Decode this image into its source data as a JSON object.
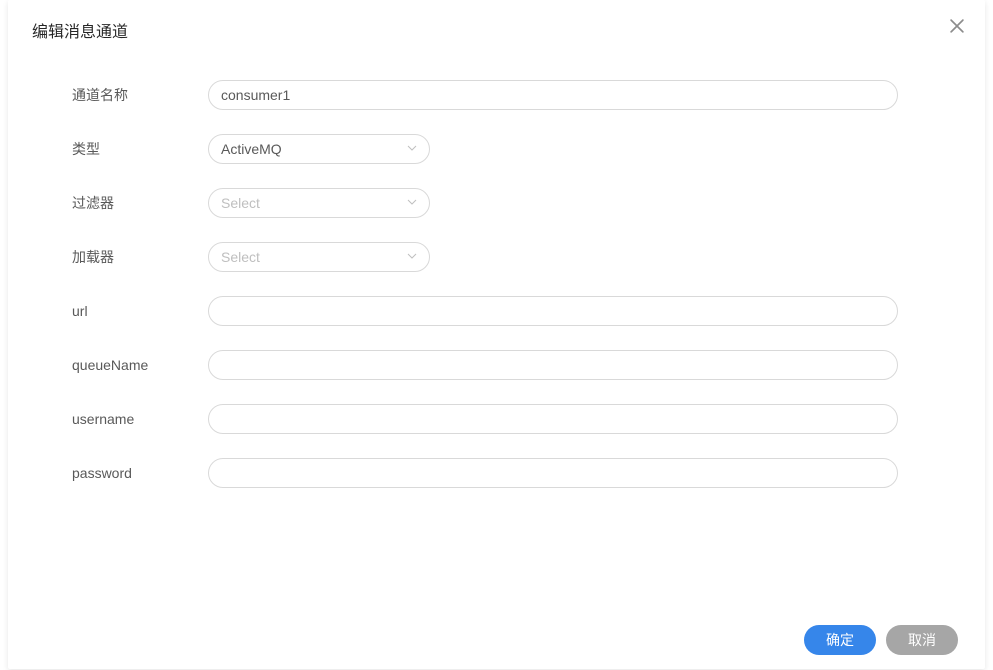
{
  "modal": {
    "title": "编辑消息通道"
  },
  "form": {
    "channelName": {
      "label": "通道名称",
      "value": "consumer1"
    },
    "type": {
      "label": "类型",
      "value": "ActiveMQ"
    },
    "filter": {
      "label": "过滤器",
      "placeholder": "Select",
      "value": ""
    },
    "loader": {
      "label": "加载器",
      "placeholder": "Select",
      "value": ""
    },
    "url": {
      "label": "url",
      "value": ""
    },
    "queueName": {
      "label": "queueName",
      "value": ""
    },
    "username": {
      "label": "username",
      "value": ""
    },
    "password": {
      "label": "password",
      "value": ""
    }
  },
  "footer": {
    "confirm": "确定",
    "cancel": "取消"
  }
}
